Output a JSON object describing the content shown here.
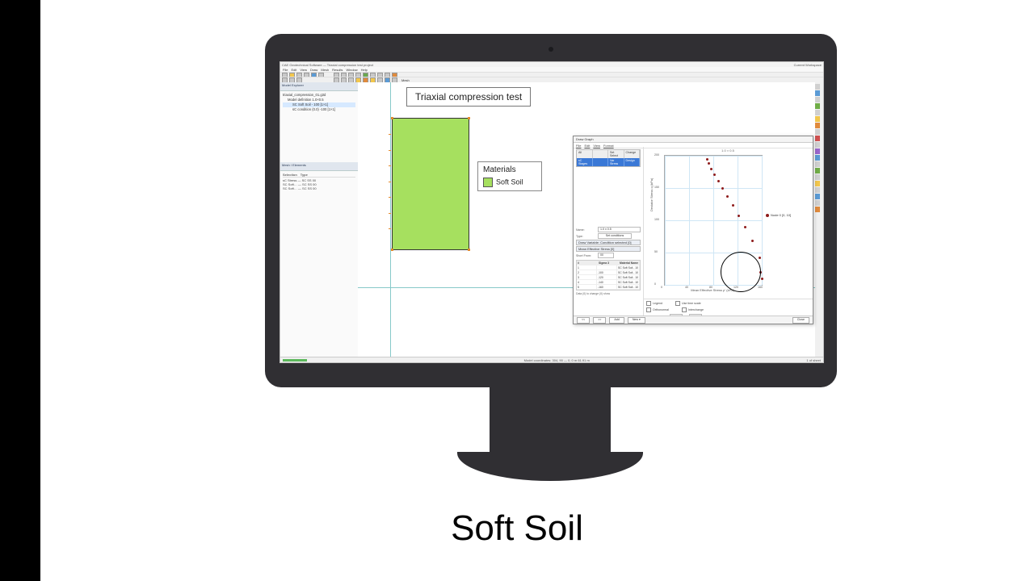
{
  "caption": "Soft Soil",
  "app": {
    "title": "CAE Geotechnical Software — Triaxial compression test project",
    "user": "Current Workspace",
    "menus": [
      "File",
      "Edit",
      "View",
      "Draw",
      "Mesh",
      "Results",
      "Window",
      "Help"
    ],
    "toolbar_text_1": "",
    "toolbar_text_2": "Mesh"
  },
  "tree": {
    "header": "Model Explorer",
    "root": "triaxial_compression_01.g3d",
    "items": [
      "Model definition 1.0×0.5",
      "SC Soft Soil - 100 [1×1]",
      "sC condition (0.0) -100 [1×1]"
    ],
    "active_index": 1
  },
  "subpanel": {
    "header": "Mesh / Elements",
    "columns": [
      "Selection",
      "Type"
    ],
    "rows": [
      [
        "sC Stress",
        "SC SS 00"
      ],
      [
        "SC Soft…",
        "SC SS 00"
      ],
      [
        "SC Soft…",
        "SC SS 00"
      ]
    ]
  },
  "canvas": {
    "label": "Triaxial compression test",
    "materials_title": "Materials",
    "material_name": "Soft Soil"
  },
  "dialog": {
    "title": "Draw Graph",
    "tabs": [
      "File",
      "Edit",
      "View",
      "Format"
    ],
    "selector": {
      "headers": [
        "All",
        "",
        "Set Select",
        "Change"
      ],
      "row": [
        "sC Stages",
        "",
        "Var Stress",
        "Design"
      ]
    },
    "name_label": "Name:",
    "name_value": "1.0 x 0.5",
    "set_label": "Type:",
    "set_conditions": "Set conditions",
    "draw_variable_label": "Draw Variable",
    "draw_variable_value": "Condition selected [0]",
    "y_label_field": "Mean Effective Stress [0]",
    "short_from_label": "Short From:",
    "short_from_value": "00",
    "table_header": [
      "#",
      "Sigma 3",
      "Material Name"
    ],
    "table_rows": [
      [
        "1",
        "",
        "SC Soft Soil - 10"
      ],
      [
        "2",
        "-100",
        "SC Soft Soil - 10"
      ],
      [
        "3",
        "-120",
        "SC Soft Soil - 10"
      ],
      [
        "4",
        "-140",
        "SC Soft Soil - 10"
      ],
      [
        "5",
        "-160",
        "SC Soft Soil - 10"
      ]
    ],
    "table_note": "Data (0) to change (0) show",
    "checkboxes": [
      "Legend",
      "Use time scale",
      "Orthonormal",
      "Interchange"
    ],
    "range_label": "X auto-range",
    "buttons": [
      "<<",
      ">>",
      "Add",
      "New ▾",
      "Close"
    ],
    "close": "Close"
  },
  "chart_data": {
    "type": "scatter",
    "title": "1.0 × 0.5",
    "xlabel": "Mean Effective Stress p' (kPa)",
    "ylabel": "Deviator Stress q (kPa)",
    "xlim": [
      0,
      160
    ],
    "ylim": [
      0,
      200
    ],
    "xticks": [
      0,
      40,
      80,
      120,
      160
    ],
    "yticks": [
      0,
      50,
      100,
      150,
      200
    ],
    "series": [
      {
        "name": "Node 0 [0, 10]",
        "color": "#8e1b1b",
        "x": [
          70,
          73,
          77,
          82,
          88,
          95,
          103,
          112,
          122,
          133,
          145,
          157,
          158,
          160
        ],
        "y": [
          195,
          188,
          180,
          171,
          161,
          150,
          137,
          123,
          107,
          89,
          68,
          42,
          20,
          10
        ]
      }
    ]
  },
  "status": {
    "coords": "Model coordinates: 304, 90 — 0, 0 m  61.91 m",
    "right": "1 of sheet"
  }
}
